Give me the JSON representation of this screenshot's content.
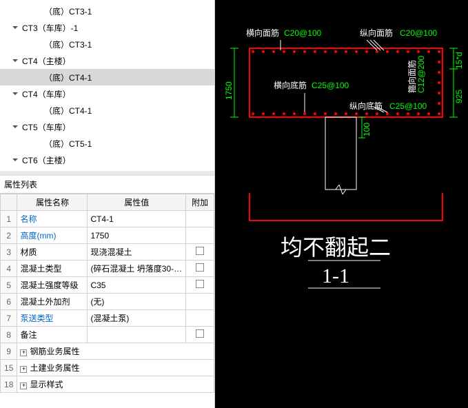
{
  "tree": {
    "items": [
      {
        "label": "（底）CT3-1",
        "level": 2,
        "caret": null,
        "selected": false
      },
      {
        "label": "CT3（车库）-1",
        "level": 1,
        "caret": "down",
        "selected": false
      },
      {
        "label": "（底）CT3-1",
        "level": 2,
        "caret": null,
        "selected": false
      },
      {
        "label": "CT4（主楼）",
        "level": 1,
        "caret": "down",
        "selected": false
      },
      {
        "label": "（底）CT4-1",
        "level": 2,
        "caret": null,
        "selected": true
      },
      {
        "label": "CT4（车库）",
        "level": 1,
        "caret": "down",
        "selected": false
      },
      {
        "label": "（底）CT4-1",
        "level": 2,
        "caret": null,
        "selected": false
      },
      {
        "label": "CT5（车库）",
        "level": 1,
        "caret": "down",
        "selected": false
      },
      {
        "label": "（底）CT5-1",
        "level": 2,
        "caret": null,
        "selected": false
      },
      {
        "label": "CT6（主楼）",
        "level": 1,
        "caret": "down",
        "selected": false
      }
    ]
  },
  "prop_panel": {
    "title": "属性列表",
    "headers": {
      "name": "属性名称",
      "value": "属性值",
      "extra": "附加"
    },
    "rows": [
      {
        "idx": "1",
        "name": "名称",
        "value": "CT4-1",
        "link": true,
        "checkbox": false
      },
      {
        "idx": "2",
        "name": "高度(mm)",
        "value": "1750",
        "link": true,
        "checkbox": false
      },
      {
        "idx": "3",
        "name": "材质",
        "value": "现浇混凝土",
        "link": false,
        "checkbox": true
      },
      {
        "idx": "4",
        "name": "混凝土类型",
        "value": "(碎石混凝土 坍落度30-5...",
        "link": false,
        "checkbox": true
      },
      {
        "idx": "5",
        "name": "混凝土强度等级",
        "value": "C35",
        "link": false,
        "checkbox": true
      },
      {
        "idx": "6",
        "name": "混凝土外加剂",
        "value": "(无)",
        "link": false,
        "checkbox": false
      },
      {
        "idx": "7",
        "name": "泵送类型",
        "value": "(混凝土泵)",
        "link": true,
        "checkbox": false
      },
      {
        "idx": "8",
        "name": "备注",
        "value": "",
        "link": false,
        "checkbox": true
      }
    ],
    "groups": [
      {
        "idx": "9",
        "label": "钢筋业务属性"
      },
      {
        "idx": "15",
        "label": "土建业务属性"
      },
      {
        "idx": "18",
        "label": "显示样式"
      }
    ]
  },
  "drawing": {
    "labels": {
      "top_left": "横向面筋",
      "top_left_spec": "C20@100",
      "top_right": "纵向面筋",
      "top_right_spec": "C20@100",
      "mid_left": "横向底筋",
      "mid_left_spec": "C25@100",
      "mid_right": "纵向底筋",
      "mid_right_spec": "C25@100",
      "side": "箍向面筋",
      "side_spec": "C12@200"
    },
    "dims": {
      "height": "1750",
      "right1": "15*d",
      "right2": "925",
      "bottom_small": "100"
    },
    "title1": "均不翻起二",
    "title2": "1-1"
  },
  "chart_data": {
    "type": "table",
    "title": "属性列表",
    "categories": [
      "属性名称",
      "属性值"
    ],
    "series": [
      {
        "name": "名称",
        "values": [
          "CT4-1"
        ]
      },
      {
        "name": "高度(mm)",
        "values": [
          "1750"
        ]
      },
      {
        "name": "材质",
        "values": [
          "现浇混凝土"
        ]
      },
      {
        "name": "混凝土类型",
        "values": [
          "(碎石混凝土 坍落度30-5...)"
        ]
      },
      {
        "name": "混凝土强度等级",
        "values": [
          "C35"
        ]
      },
      {
        "name": "混凝土外加剂",
        "values": [
          "(无)"
        ]
      },
      {
        "name": "泵送类型",
        "values": [
          "(混凝土泵)"
        ]
      },
      {
        "name": "备注",
        "values": [
          ""
        ]
      }
    ]
  }
}
